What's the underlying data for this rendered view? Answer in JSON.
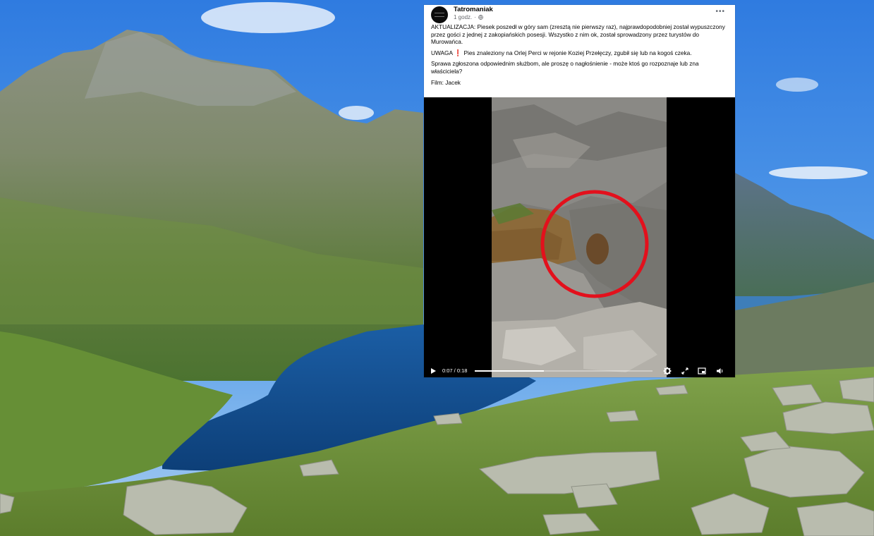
{
  "post": {
    "page_name": "Tatromaniak",
    "time_ago": "1 godz.",
    "privacy_icon": "globe-icon",
    "more_icon": "more-options-icon",
    "paragraphs": {
      "update": "AKTUALIZACJA: Piesek poszedł w góry sam (zresztą nie pierwszy raz), najprawdopodobniej został wypuszczony przez gości z jednej z zakopiańskich posesji. Wszystko z nim ok, został sprowadzony przez turystów do Murowańca.",
      "warning_label": "UWAGA",
      "warning_text": "Pies znaleziony na Orlej Perci w rejonie Koziej Przełęczy, zgubił się lub na kogoś czeka.",
      "request": "Sprawa zgłoszona odpowiednim służbom, ale proszę o nagłośnienie - może ktoś go rozpoznaje lub zna właściciela?",
      "credit": "Film: Jacek"
    }
  },
  "video": {
    "current_time": "0:07",
    "duration": "0:18",
    "time_text": "0:07 / 0:18",
    "progress_fraction": 0.39,
    "highlight_color": "#e3101c",
    "icons": [
      "play-icon",
      "settings-icon",
      "fullscreen-icon",
      "pip-icon",
      "volume-icon"
    ]
  },
  "colors": {
    "sky": "#4c8fe0",
    "lake": "#134e8e",
    "grass": "#6e9a3a"
  }
}
